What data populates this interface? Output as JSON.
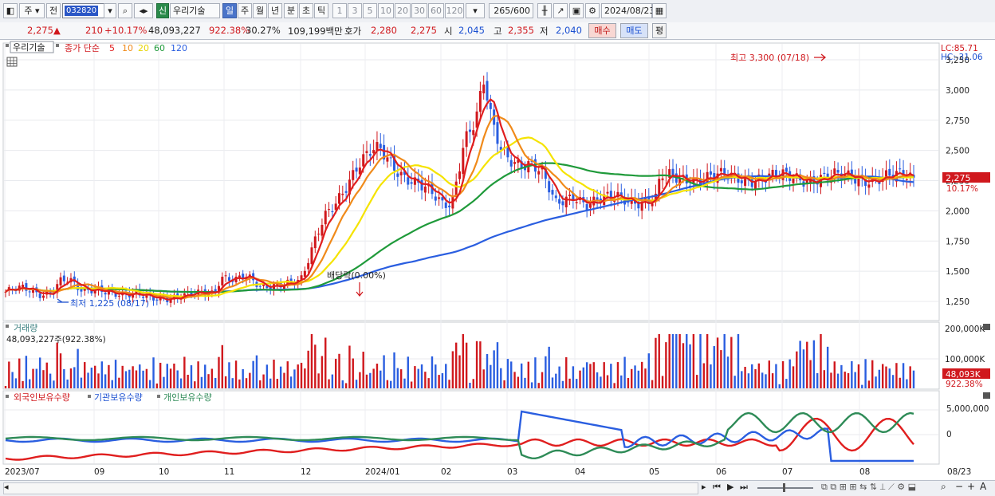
{
  "toolbar": {
    "mode": "주",
    "jeon": "전",
    "code": "032820",
    "stock_name_tag": "신",
    "stock_name": "우리기술",
    "periods": [
      "일",
      "주",
      "월",
      "년",
      "분",
      "초",
      "틱"
    ],
    "active_period": "일",
    "intervals": [
      "1",
      "3",
      "5",
      "10",
      "20",
      "30",
      "60",
      "120"
    ],
    "count": "265",
    "count_total": "/600",
    "date": "2024/08/23"
  },
  "quote": {
    "price": "2,275",
    "change": "210",
    "change_pct": "+10.17%",
    "volume": "48,093,227",
    "volume_ratio": "922.38%",
    "turnover": "30.27%",
    "amount": "109,199백만",
    "hoga_label": "호가",
    "hoga_ask": "2,280",
    "hoga_bid": "2,275",
    "open_label": "시",
    "open": "2,045",
    "high_label": "고",
    "high": "2,355",
    "low_label": "저",
    "low": "2,040",
    "buy": "매수",
    "sell": "매도",
    "avg": "평"
  },
  "price_panel": {
    "legend_name": "우리기술",
    "legend_ma_label": "종가 단순",
    "ma_labels": [
      "5",
      "10",
      "20",
      "60",
      "120"
    ],
    "ma_colors": [
      "#e01e1e",
      "#f08a1a",
      "#f5e300",
      "#1f9a3a",
      "#2a5ee0"
    ],
    "lc": "LC:85.71",
    "hc": "HC:-31.06",
    "yticks": [
      "3,250",
      "3,000",
      "2,750",
      "2,500",
      "2,250",
      "2,000",
      "1,750",
      "1,500",
      "1,250"
    ],
    "last_price": "2,275",
    "last_pct": "10.17%",
    "max_label": "최고 3,300 (07/18)",
    "min_label": "최저 1,225 (08/17)",
    "dividend_label": "배당락(0.00%)"
  },
  "volume_panel": {
    "title": "거래량",
    "value_label": "48,093,227주(922.38%)",
    "yticks": [
      "200,000K",
      "100,000K"
    ],
    "last": "48,093K",
    "last_pct": "922.38%"
  },
  "holding_panel": {
    "legend": [
      "외국인보유수량",
      "기관보유수량",
      "개인보유수량"
    ],
    "colors": [
      "#e01e1e",
      "#2a5ee0",
      "#2e8b57"
    ],
    "yticks": [
      "5,000,000",
      "0"
    ]
  },
  "xaxis": {
    "labels": [
      "2023/07",
      "09",
      "10",
      "11",
      "12",
      "2024/01",
      "02",
      "03",
      "04",
      "05",
      "06",
      "07",
      "08"
    ],
    "end_label": "08/23"
  }
}
